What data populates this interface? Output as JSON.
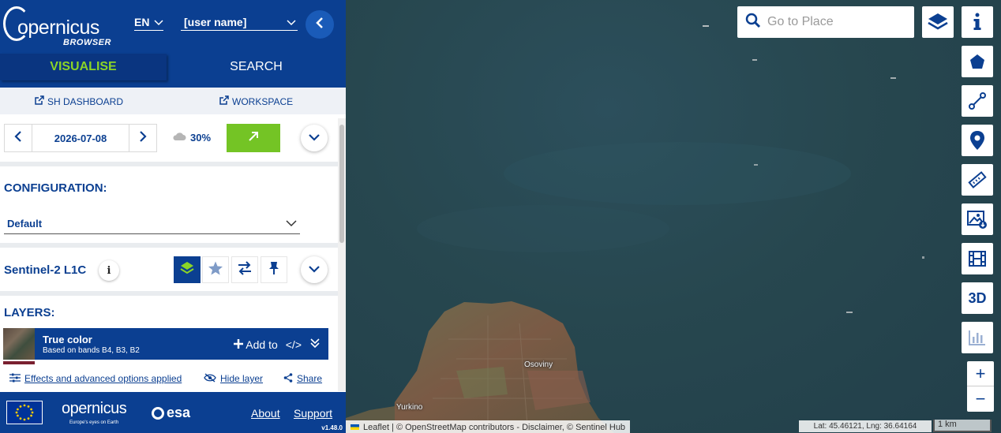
{
  "app": {
    "logo_text": "opernicus",
    "logo_sub": "BROWSER",
    "language": "EN",
    "user_name": "[user name]"
  },
  "tabs": {
    "visualise": "VISUALISE",
    "search": "SEARCH"
  },
  "links": {
    "sh_dashboard": "SH DASHBOARD",
    "workspace": "WORKSPACE"
  },
  "date_panel": {
    "date": "2026-07-08",
    "cloud_cover": "30%"
  },
  "configuration": {
    "title": "CONFIGURATION:",
    "selected": "Default"
  },
  "collection": {
    "name": "Sentinel-2 L1C",
    "info_glyph": "i"
  },
  "layers": {
    "title": "LAYERS:",
    "items": [
      {
        "name": "True color",
        "description": "Based on bands B4, B3, B2",
        "add_label": "Add to",
        "code_glyph": "</>"
      }
    ]
  },
  "layer_actions": {
    "effects": "Effects and advanced options applied",
    "hide": "Hide layer",
    "share": "Share"
  },
  "footer": {
    "logo_text": "opernicus",
    "logo_tagline": "Europe's eyes on Earth",
    "esa_text": "esa",
    "about": "About",
    "support": "Support",
    "version": "v1.48.0"
  },
  "map": {
    "search_placeholder": "Go to Place",
    "place_labels": {
      "osoviny": "Osoviny",
      "yurkino": "Yurkino"
    },
    "three_d_label": "3D",
    "zoom_in": "+",
    "zoom_out": "−",
    "attribution": {
      "leaflet": "Leaflet",
      "rest": "| © OpenStreetMap contributors - Disclaimer, © Sentinel Hub"
    },
    "coordinates": "Lat: 45.46121, Lng: 36.64164",
    "scale": "1 km"
  },
  "colors": {
    "brand_blue": "#0b3f91",
    "accent_green": "#8bd427",
    "button_green": "#74c425",
    "water": "#27474f"
  }
}
